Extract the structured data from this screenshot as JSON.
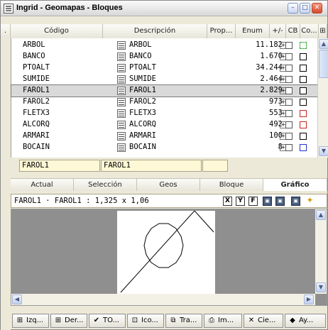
{
  "window": {
    "title": "Ingrid - Geomapas - Bloques",
    "minimize": "–",
    "restore": "□",
    "close": "✕"
  },
  "columns": {
    "dot": ".",
    "codigo": "Código",
    "descripcion": "Descripción",
    "prop": "Prop...",
    "enum": "Enum",
    "pm": "+/-",
    "cb": "CB",
    "co": "Co...",
    "extra": "⊞"
  },
  "rows": [
    {
      "code": "ARBOL",
      "desc": "ARBOL",
      "enum": "11.182",
      "selected": false,
      "co_color": "#33aa33",
      "co_dashed": true
    },
    {
      "code": "BANCO",
      "desc": "BANCO",
      "enum": "1.670",
      "selected": false,
      "co_color": "#000000",
      "co_dashed": false
    },
    {
      "code": "PTOALT",
      "desc": "PTOALT",
      "enum": "34.244",
      "selected": false,
      "co_color": "#000000",
      "co_dashed": false
    },
    {
      "code": "SUMIDE",
      "desc": "SUMIDE",
      "enum": "2.464",
      "selected": false,
      "co_color": "#000000",
      "co_dashed": false
    },
    {
      "code": "FAROL1",
      "desc": "FAROL1",
      "enum": "2.829",
      "selected": true,
      "co_color": "#000000",
      "co_dashed": false
    },
    {
      "code": "FAROL2",
      "desc": "FAROL2",
      "enum": "973",
      "selected": false,
      "co_color": "#000000",
      "co_dashed": false
    },
    {
      "code": "FLETX3",
      "desc": "FLETX3",
      "enum": "553",
      "selected": false,
      "co_color": "#cc2222",
      "co_dashed": false
    },
    {
      "code": "ALCORQ",
      "desc": "ALCORQ",
      "enum": "492",
      "selected": false,
      "co_color": "#cc2222",
      "co_dashed": false
    },
    {
      "code": "ARMARI",
      "desc": "ARMARI",
      "enum": "100",
      "selected": false,
      "co_color": "#000000",
      "co_dashed": false
    },
    {
      "code": "BOCAIN",
      "desc": "BOCAIN",
      "enum": "8",
      "selected": false,
      "co_color": "#2233cc",
      "co_dashed": false
    }
  ],
  "edit": {
    "code": "FAROL1",
    "desc": "FAROL1"
  },
  "tabs": [
    "Actual",
    "Selección",
    "Geos",
    "Bloque",
    "Gráfico"
  ],
  "active_tab": "Gráfico",
  "graphic": {
    "info": "FAROL1 · FAROL1 : 1,325 x 1,06",
    "btn_x": "X",
    "btn_y": "Y",
    "btn_f": "F"
  },
  "taskbar": [
    {
      "icon": "⊞",
      "label": "Izq..."
    },
    {
      "icon": "⊞",
      "label": "Der..."
    },
    {
      "icon": "✔",
      "label": "TO..."
    },
    {
      "icon": "⊡",
      "label": "Ico..."
    },
    {
      "icon": "⧉",
      "label": "Tra..."
    },
    {
      "icon": "⎙",
      "label": "Im..."
    },
    {
      "icon": "✕",
      "label": "Cie..."
    },
    {
      "icon": "◆",
      "label": "Ay..."
    }
  ]
}
